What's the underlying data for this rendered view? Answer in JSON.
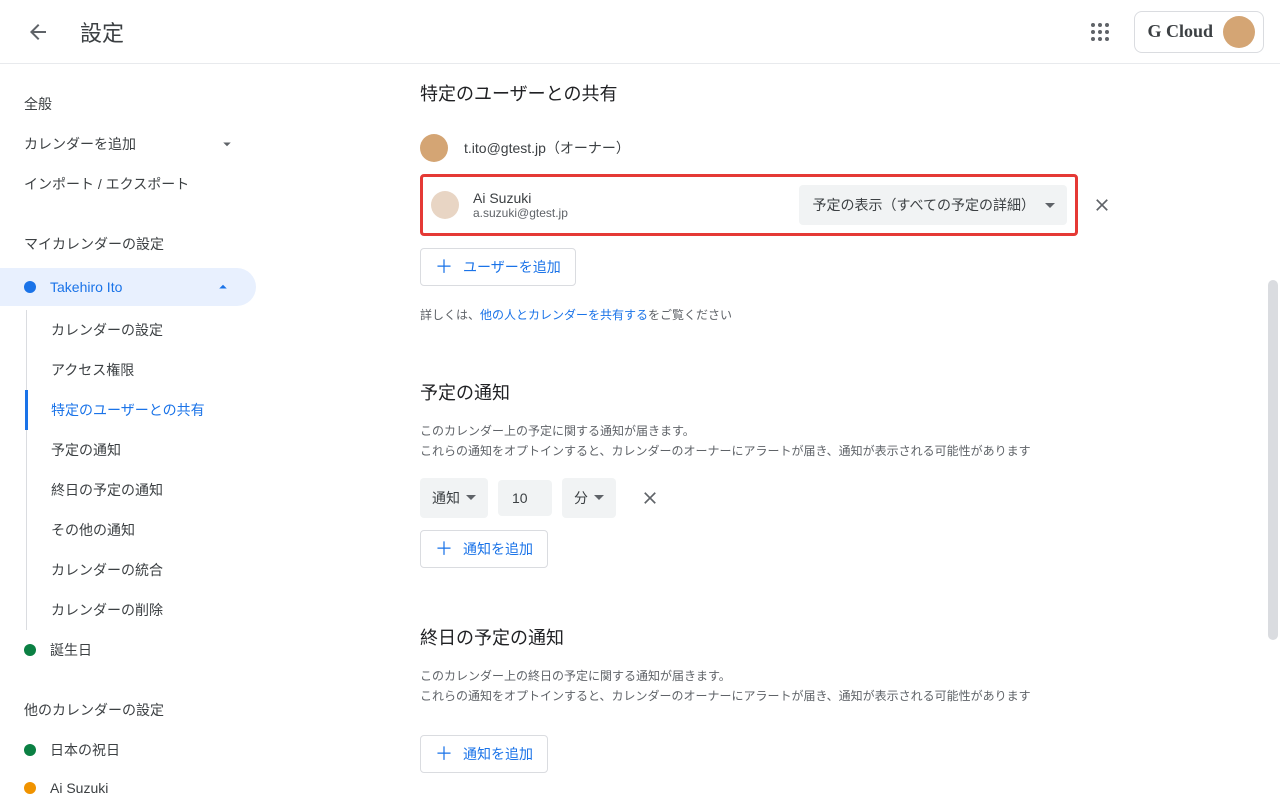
{
  "header": {
    "title": "設定",
    "brand": "G Cloud"
  },
  "sidebar": {
    "general": "全般",
    "add_calendar": "カレンダーを追加",
    "import_export": "インポート / エクスポート",
    "my_calendars_label": "マイカレンダーの設定",
    "active_calendar": "Takehiro Ito",
    "sub_items": [
      "カレンダーの設定",
      "アクセス権限",
      "特定のユーザーとの共有",
      "予定の通知",
      "終日の予定の通知",
      "その他の通知",
      "カレンダーの統合",
      "カレンダーの削除"
    ],
    "birthdays": "誕生日",
    "other_calendars_label": "他のカレンダーの設定",
    "japan_holidays": "日本の祝日",
    "ai_suzuki": "Ai Suzuki"
  },
  "share_section": {
    "title": "特定のユーザーとの共有",
    "owner_email": "t.ito@gtest.jp（オーナー）",
    "shared_user_name": "Ai Suzuki",
    "shared_user_email": "a.suzuki@gtest.jp",
    "permission": "予定の表示（すべての予定の詳細）",
    "add_user": "ユーザーを追加",
    "help_prefix": "詳しくは、",
    "help_link": "他の人とカレンダーを共有する",
    "help_suffix": "をご覧ください"
  },
  "event_notif": {
    "title": "予定の通知",
    "desc1": "このカレンダー上の予定に関する通知が届きます。",
    "desc2": "これらの通知をオプトインすると、カレンダーのオーナーにアラートが届き、通知が表示される可能性があります",
    "type": "通知",
    "value": "10",
    "unit": "分",
    "add": "通知を追加"
  },
  "allday_notif": {
    "title": "終日の予定の通知",
    "desc1": "このカレンダー上の終日の予定に関する通知が届きます。",
    "desc2": "これらの通知をオプトインすると、カレンダーのオーナーにアラートが届き、通知が表示される可能性があります",
    "add": "通知を追加"
  }
}
